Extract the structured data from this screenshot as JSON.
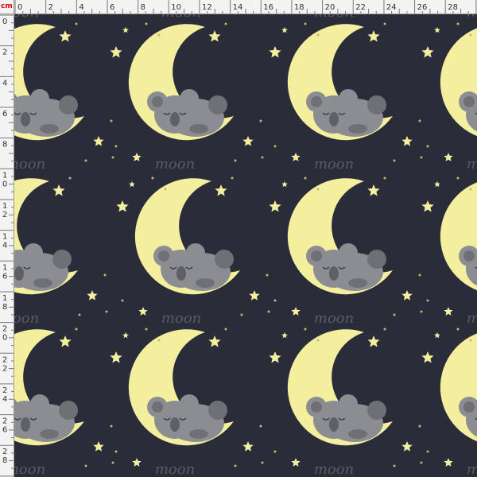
{
  "ruler": {
    "unit": "cm",
    "top_labels": [
      "0",
      "2",
      "4",
      "6",
      "8",
      "10",
      "12",
      "14",
      "16",
      "18",
      "20",
      "22",
      "24",
      "26",
      "28"
    ],
    "left_labels": [
      "0",
      "2",
      "4",
      "6",
      "8",
      "10",
      "12",
      "14",
      "16",
      "18",
      "20",
      "22",
      "24",
      "26",
      "28"
    ]
  },
  "pattern": {
    "motif": "sleeping koala on crescent moon",
    "word": "moon",
    "colors": {
      "background": "#2b2c3a",
      "moon": "#f3ef9e",
      "koala": "#8c8d92",
      "koala_shade": "#6f7075",
      "star": "#f3ef9e",
      "word": "#5a5a62",
      "ruler_bg": "#f3f3f3",
      "ruler_text": "#333333",
      "unit_text": "#d20000"
    }
  }
}
